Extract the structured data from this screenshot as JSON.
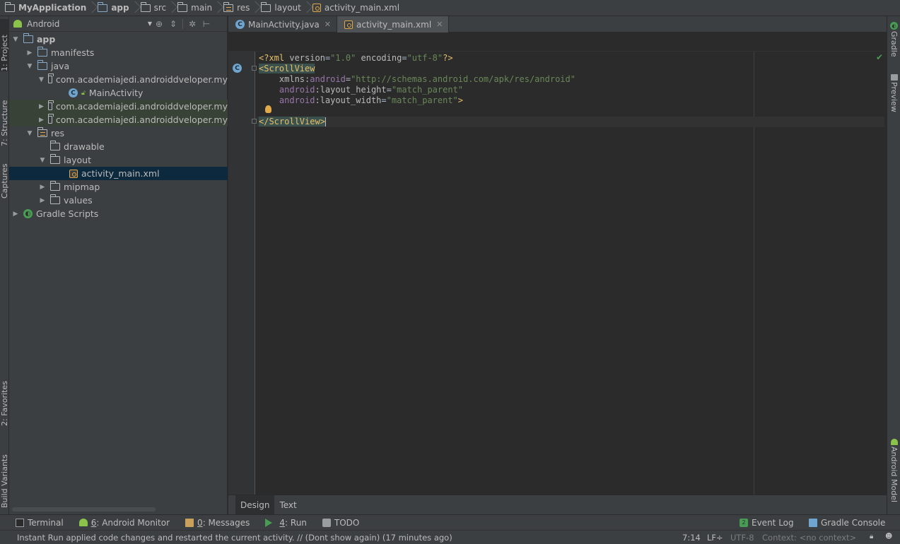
{
  "navbar": {
    "crumbs": [
      "MyApplication",
      "app",
      "src",
      "main",
      "res",
      "layout",
      "activity_main.xml"
    ]
  },
  "left_strip": {
    "tabs": [
      "1: Project",
      "7: Structure",
      "Captures",
      "2: Favorites",
      "Build Variants"
    ]
  },
  "right_strip": {
    "tabs": [
      "Gradle",
      "Preview",
      "Android Model"
    ]
  },
  "project_panel": {
    "view_mode": "Android",
    "tree": [
      {
        "label": "app",
        "arrow": "▼",
        "icon": "folder-icon"
      },
      {
        "label": "manifests",
        "arrow": "▶",
        "icon": "folder-icon"
      },
      {
        "label": "java",
        "arrow": "▼",
        "icon": "folder-icon"
      },
      {
        "label": "com.academiajedi.androiddveloper.my",
        "arrow": "▼",
        "icon": "package-icon"
      },
      {
        "label": "MainActivity",
        "arrow": "",
        "icon": "class-icon"
      },
      {
        "label": "com.academiajedi.androiddveloper.my",
        "arrow": "▶",
        "icon": "package-icon"
      },
      {
        "label": "com.academiajedi.androiddveloper.my",
        "arrow": "▶",
        "icon": "package-icon"
      },
      {
        "label": "res",
        "arrow": "▼",
        "icon": "res-folder-icon"
      },
      {
        "label": "drawable",
        "arrow": "",
        "icon": "folder-icon"
      },
      {
        "label": "layout",
        "arrow": "▼",
        "icon": "folder-icon"
      },
      {
        "label": "activity_main.xml",
        "arrow": "",
        "icon": "xml-file-icon"
      },
      {
        "label": "mipmap",
        "arrow": "▶",
        "icon": "folder-icon"
      },
      {
        "label": "values",
        "arrow": "▶",
        "icon": "folder-icon"
      },
      {
        "label": "Gradle Scripts",
        "arrow": "▶",
        "icon": "gradle-icon"
      }
    ]
  },
  "editor_tabs": [
    {
      "label": "MainActivity.java",
      "icon": "class-icon",
      "active": false
    },
    {
      "label": "activity_main.xml",
      "icon": "xml-file-icon",
      "active": true
    }
  ],
  "code": {
    "line1": {
      "pi_open": "<?xml ",
      "a1": "version",
      "eq1": "=",
      "v1": "\"1.0\"",
      "sp": " ",
      "a2": "encoding",
      "eq2": "=",
      "v2": "\"utf-8\"",
      "pi_close": "?>"
    },
    "line2": {
      "tag": "<ScrollView"
    },
    "line3": {
      "attr": "xmlns:",
      "ns": "android",
      "eq": "=",
      "val": "\"http://schemas.android.com/apk/res/android\""
    },
    "line4": {
      "ns": "android",
      "attr": ":layout_height",
      "eq": "=",
      "val": "\"match_parent\""
    },
    "line5": {
      "ns": "android",
      "attr": ":layout_width",
      "eq": "=",
      "val": "\"match_parent\"",
      "close": ">"
    },
    "line7": {
      "tag": "</ScrollView>"
    }
  },
  "mode_tabs": [
    {
      "label": "Design",
      "active": true
    },
    {
      "label": "Text",
      "active": false
    }
  ],
  "bottom_tools": {
    "terminal": "Terminal",
    "android_monitor_num": "6",
    "android_monitor": ": Android Monitor",
    "messages_num": "0",
    "messages": ": Messages",
    "run_num": "4",
    "run": ": Run",
    "todo": "TODO",
    "event_log_count": "2",
    "event_log": "Event Log",
    "gradle_console": "Gradle Console"
  },
  "status": {
    "message": "Instant Run applied code changes and restarted the current activity. // (Dont show again) (17 minutes ago)",
    "position": "7:14",
    "line_sep": "LF÷",
    "encoding": "UTF-8",
    "context": "Context: <no context>"
  },
  "colors": {
    "background": "#2b2b2b",
    "panel": "#3c3f41",
    "selection": "#0d293e",
    "xml_tag": "#e8bf6a",
    "xml_value": "#6a8759",
    "xml_namespace": "#9876aa",
    "android_green": "#8bc34a"
  }
}
